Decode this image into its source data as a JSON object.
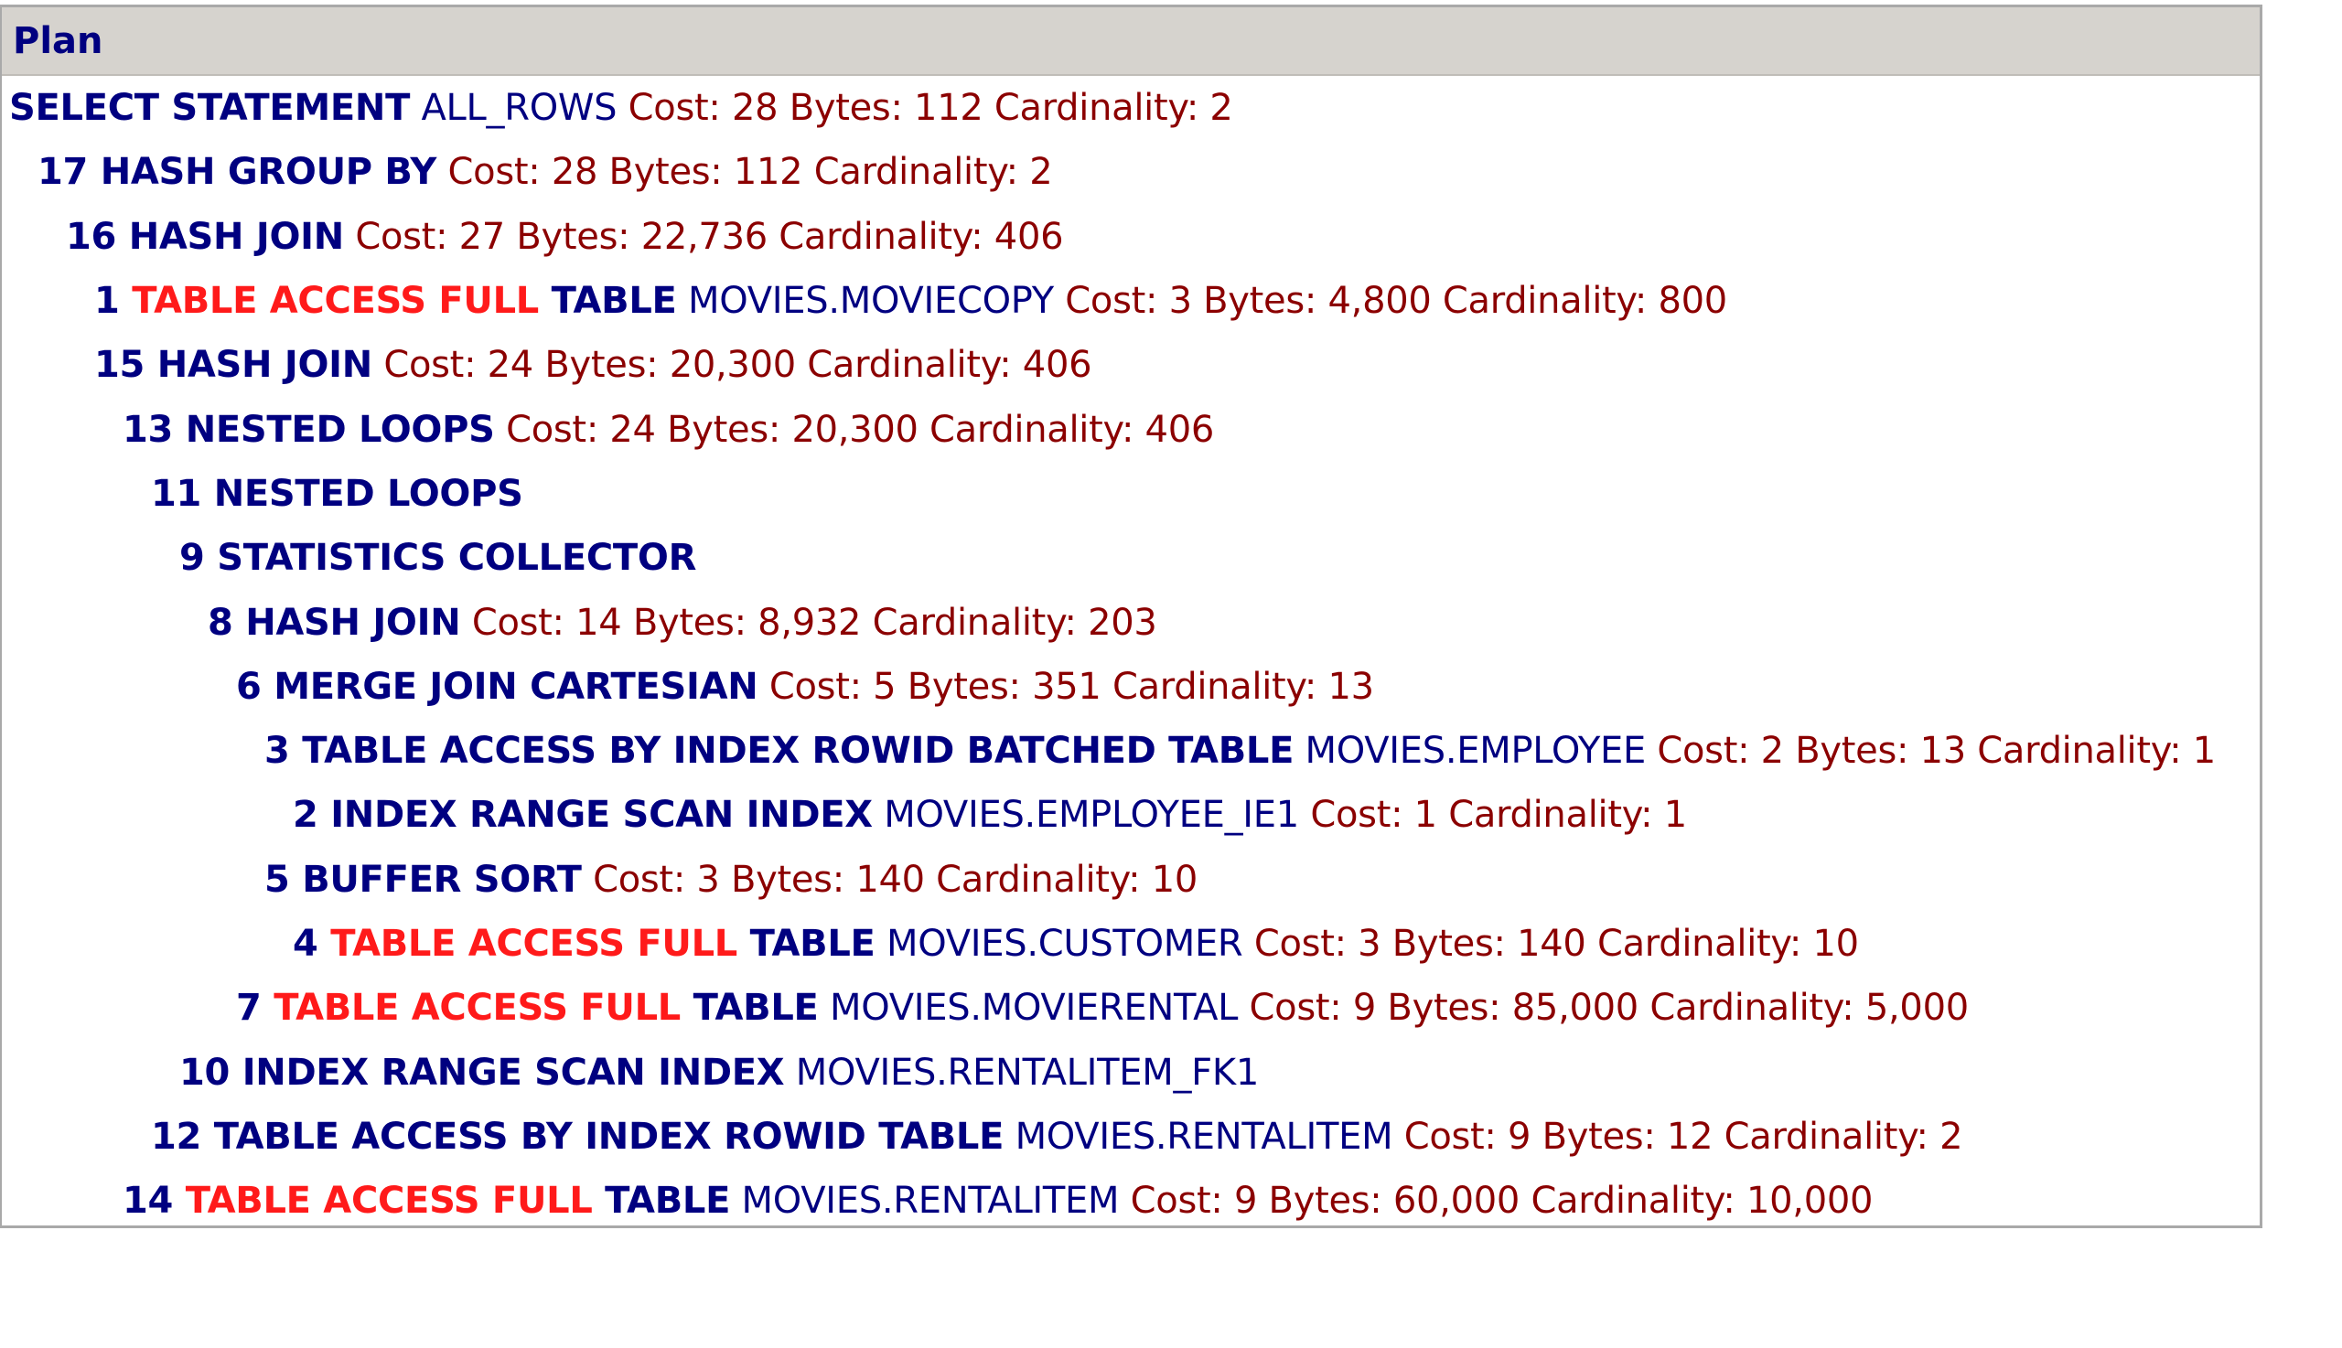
{
  "header": {
    "title": "Plan"
  },
  "rows": [
    {
      "indent": 0,
      "id": "",
      "op": "SELECT STATEMENT",
      "op_red": "",
      "op_tail": "",
      "object": "ALL_ROWS",
      "stats": "Cost: 28 Bytes: 112 Cardinality: 2"
    },
    {
      "indent": 1,
      "id": "17",
      "op": "HASH GROUP BY",
      "op_red": "",
      "op_tail": "",
      "object": "",
      "stats": "Cost: 28 Bytes: 112 Cardinality: 2"
    },
    {
      "indent": 2,
      "id": "16",
      "op": "HASH JOIN",
      "op_red": "",
      "op_tail": "",
      "object": "",
      "stats": "Cost: 27 Bytes: 22,736 Cardinality: 406"
    },
    {
      "indent": 3,
      "id": "1",
      "op": "",
      "op_red": "TABLE ACCESS FULL",
      "op_tail": "TABLE",
      "object": "MOVIES.MOVIECOPY",
      "stats": "Cost: 3 Bytes: 4,800 Cardinality: 800"
    },
    {
      "indent": 3,
      "id": "15",
      "op": "HASH JOIN",
      "op_red": "",
      "op_tail": "",
      "object": "",
      "stats": "Cost: 24 Bytes: 20,300 Cardinality: 406"
    },
    {
      "indent": 4,
      "id": "13",
      "op": "NESTED LOOPS",
      "op_red": "",
      "op_tail": "",
      "object": "",
      "stats": "Cost: 24 Bytes: 20,300 Cardinality: 406"
    },
    {
      "indent": 5,
      "id": "11",
      "op": "NESTED LOOPS",
      "op_red": "",
      "op_tail": "",
      "object": "",
      "stats": ""
    },
    {
      "indent": 6,
      "id": "9",
      "op": "STATISTICS COLLECTOR",
      "op_red": "",
      "op_tail": "",
      "object": "",
      "stats": ""
    },
    {
      "indent": 7,
      "id": "8",
      "op": "HASH JOIN",
      "op_red": "",
      "op_tail": "",
      "object": "",
      "stats": "Cost: 14 Bytes: 8,932 Cardinality: 203"
    },
    {
      "indent": 8,
      "id": "6",
      "op": "MERGE JOIN CARTESIAN",
      "op_red": "",
      "op_tail": "",
      "object": "",
      "stats": "Cost: 5 Bytes: 351 Cardinality: 13"
    },
    {
      "indent": 9,
      "id": "3",
      "op": "TABLE ACCESS BY INDEX ROWID BATCHED TABLE",
      "op_red": "",
      "op_tail": "",
      "object": "MOVIES.EMPLOYEE",
      "stats": "Cost: 2 Bytes: 13 Cardinality: 1"
    },
    {
      "indent": 10,
      "id": "2",
      "op": "INDEX RANGE SCAN INDEX",
      "op_red": "",
      "op_tail": "",
      "object": "MOVIES.EMPLOYEE_IE1",
      "stats": "Cost: 1 Cardinality: 1"
    },
    {
      "indent": 9,
      "id": "5",
      "op": "BUFFER SORT",
      "op_red": "",
      "op_tail": "",
      "object": "",
      "stats": "Cost: 3 Bytes: 140 Cardinality: 10"
    },
    {
      "indent": 10,
      "id": "4",
      "op": "",
      "op_red": "TABLE ACCESS FULL",
      "op_tail": "TABLE",
      "object": "MOVIES.CUSTOMER",
      "stats": "Cost: 3 Bytes: 140 Cardinality: 10"
    },
    {
      "indent": 8,
      "id": "7",
      "op": "",
      "op_red": "TABLE ACCESS FULL",
      "op_tail": "TABLE",
      "object": "MOVIES.MOVIERENTAL",
      "stats": "Cost: 9 Bytes: 85,000 Cardinality: 5,000"
    },
    {
      "indent": 6,
      "id": "10",
      "op": "INDEX RANGE SCAN INDEX",
      "op_red": "",
      "op_tail": "",
      "object": "MOVIES.RENTALITEM_FK1",
      "stats": ""
    },
    {
      "indent": 5,
      "id": "12",
      "op": "TABLE ACCESS BY INDEX ROWID TABLE",
      "op_red": "",
      "op_tail": "",
      "object": "MOVIES.RENTALITEM",
      "stats": "Cost: 9 Bytes: 12 Cardinality: 2"
    },
    {
      "indent": 4,
      "id": "14",
      "op": "",
      "op_red": "TABLE ACCESS FULL",
      "op_tail": "TABLE",
      "object": "MOVIES.RENTALITEM",
      "stats": "Cost: 9 Bytes: 60,000 Cardinality: 10,000"
    }
  ]
}
